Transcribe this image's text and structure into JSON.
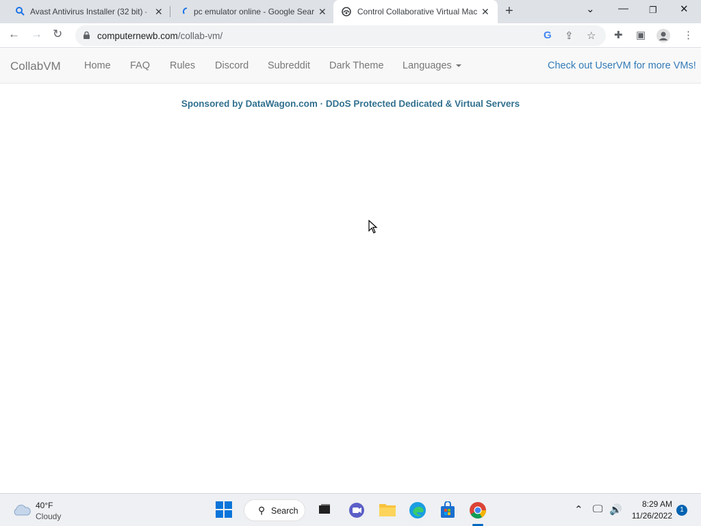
{
  "browser": {
    "tabs": [
      {
        "title": "Avast Antivirus Installer (32 bit) -",
        "icon": "search-icon",
        "active": false
      },
      {
        "title": "pc emulator online - Google Sear",
        "icon": "loading-icon",
        "active": false
      },
      {
        "title": "Control Collaborative Virtual Mac",
        "icon": "collabvm-icon",
        "active": true
      }
    ],
    "new_tab_label": "+",
    "url_domain": "computernewb.com",
    "url_path": "/collab-vm/"
  },
  "site": {
    "brand": "CollabVM",
    "nav": [
      "Home",
      "FAQ",
      "Rules",
      "Discord",
      "Subreddit",
      "Dark Theme"
    ],
    "languages_label": "Languages",
    "uservm_link": "Check out UserVM for more VMs!",
    "sponsor_text": "Sponsored by DataWagon.com · DDoS Protected Dedicated & Virtual Servers"
  },
  "taskbar": {
    "weather_temp": "40°F",
    "weather_cond": "Cloudy",
    "search_label": "Search",
    "time": "8:29 AM",
    "date": "11/26/2022",
    "notification_count": "1"
  },
  "colors": {
    "link": "#337ab7",
    "sponsor": "#31708f",
    "navbar_bg": "#f8f8f8"
  }
}
